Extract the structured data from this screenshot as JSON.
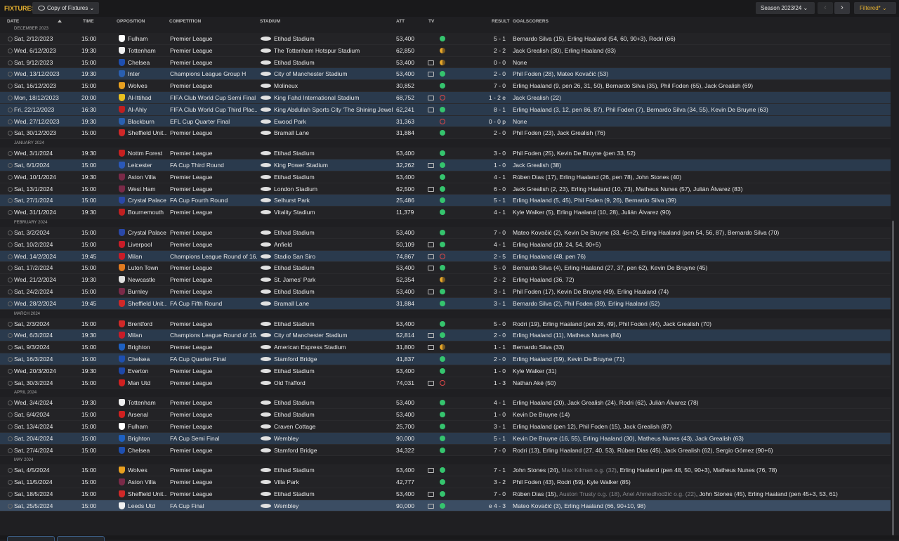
{
  "header": {
    "title": "FIXTURES",
    "view_label": "Copy of Fixtures",
    "season_label": "Season 2023/24",
    "filter_label": "Filtered*"
  },
  "columns": {
    "date": "DATE",
    "time": "TIME",
    "opposition": "OPPOSITION",
    "competition": "COMPETITION",
    "stadium": "STADIUM",
    "att": "ATT",
    "tv": "TV",
    "result": "RESULT",
    "goalscorers": "GOALSCORERS"
  },
  "colors": {
    "accent": "#e7b230",
    "win": "#35c46e",
    "draw": "#e3a52a",
    "loss": "#e04848",
    "highlight": "#2a3a4d",
    "selected": "#3b4d63"
  },
  "months": [
    {
      "label": "DECEMBER 2023",
      "rows": [
        {
          "date": "Sat, 2/12/2023",
          "time": "15:00",
          "opp": "Fulham",
          "crest": "#ffffff",
          "comp": "Premier League",
          "stadium": "Etihad Stadium",
          "att": "53,400",
          "tv": false,
          "status": "win",
          "result": "5 - 1",
          "scorers": "Bernardo Silva (15), Erling Haaland (54, 60, 90+3), Rodri (66)",
          "hl": false
        },
        {
          "date": "Wed, 6/12/2023",
          "time": "19:30",
          "opp": "Tottenham",
          "crest": "#f0f0f0",
          "comp": "Premier League",
          "stadium": "The Tottenham Hotspur Stadium",
          "att": "62,850",
          "tv": false,
          "status": "draw",
          "result": "2 - 2",
          "scorers": "Jack Grealish (30), Erling Haaland (83)",
          "hl": false
        },
        {
          "date": "Sat, 9/12/2023",
          "time": "15:00",
          "opp": "Chelsea",
          "crest": "#1e4fb0",
          "comp": "Premier League",
          "stadium": "Etihad Stadium",
          "att": "53,400",
          "tv": true,
          "status": "draw",
          "result": "0 - 0",
          "scorers": "None",
          "hl": false
        },
        {
          "date": "Wed, 13/12/2023",
          "time": "19:30",
          "opp": "Inter",
          "crest": "#2a5fb0",
          "comp": "Champions League Group H",
          "stadium": "City of Manchester Stadium",
          "att": "53,400",
          "tv": true,
          "status": "win",
          "result": "2 - 0",
          "scorers": "Phil Foden (28), Mateo Kovačić (53)",
          "hl": true
        },
        {
          "date": "Sat, 16/12/2023",
          "time": "15:00",
          "opp": "Wolves",
          "crest": "#e8a020",
          "comp": "Premier League",
          "stadium": "Molineux",
          "att": "30,852",
          "tv": false,
          "status": "win",
          "result": "7 - 0",
          "scorers": "Erling Haaland (9, pen 26, 31, 50), Bernardo Silva (35), Phil Foden (65), Jack Grealish (69)",
          "hl": false
        },
        {
          "date": "Mon, 18/12/2023",
          "time": "20:00",
          "opp": "Al-Ittihad",
          "crest": "#e8c020",
          "comp": "FIFA Club World Cup Semi Final",
          "stadium": "King Fahd International Stadium",
          "att": "68,752",
          "tv": true,
          "status": "loss",
          "result": "1 - 2 e",
          "scorers": "Jack Grealish (22)",
          "hl": true
        },
        {
          "date": "Fri, 22/12/2023",
          "time": "16:30",
          "opp": "Al-Ahly",
          "crest": "#c02020",
          "comp": "FIFA Club World Cup Third Plac...",
          "stadium": "King Abdullah Sports City 'The Shining Jewel'",
          "att": "62,241",
          "tv": true,
          "status": "win",
          "result": "8 - 1",
          "scorers": "Erling Haaland (3, 12, pen 86, 87), Phil Foden (7), Bernardo Silva (34, 55), Kevin De Bruyne (63)",
          "hl": true
        },
        {
          "date": "Wed, 27/12/2023",
          "time": "19:30",
          "opp": "Blackburn",
          "crest": "#2a60b0",
          "comp": "EFL Cup Quarter Final",
          "stadium": "Ewood Park",
          "att": "31,363",
          "tv": false,
          "status": "loss",
          "result": "0 - 0 p",
          "scorers": "None",
          "hl": true
        },
        {
          "date": "Sat, 30/12/2023",
          "time": "15:00",
          "opp": "Sheffield Unit...",
          "crest": "#d02828",
          "comp": "Premier League",
          "stadium": "Bramall Lane",
          "att": "31,884",
          "tv": false,
          "status": "win",
          "result": "2 - 0",
          "scorers": "Phil Foden (23), Jack Grealish (76)",
          "hl": false
        }
      ]
    },
    {
      "label": "JANUARY 2024",
      "rows": [
        {
          "date": "Wed, 3/1/2024",
          "time": "19:30",
          "opp": "Nottm Forest",
          "crest": "#c82020",
          "comp": "Premier League",
          "stadium": "Etihad Stadium",
          "att": "53,400",
          "tv": false,
          "status": "win",
          "result": "3 - 0",
          "scorers": "Phil Foden (25), Kevin De Bruyne (pen 33, 52)",
          "hl": false
        },
        {
          "date": "Sat, 6/1/2024",
          "time": "15:00",
          "opp": "Leicester",
          "crest": "#2a58b8",
          "comp": "FA Cup Third Round",
          "stadium": "King Power Stadium",
          "att": "32,262",
          "tv": true,
          "status": "win",
          "result": "1 - 0",
          "scorers": "Jack Grealish (38)",
          "hl": true
        },
        {
          "date": "Wed, 10/1/2024",
          "time": "19:30",
          "opp": "Aston Villa",
          "crest": "#7a2a48",
          "comp": "Premier League",
          "stadium": "Etihad Stadium",
          "att": "53,400",
          "tv": false,
          "status": "win",
          "result": "4 - 1",
          "scorers": "Rúben Dias (17), Erling Haaland (26, pen 78), John Stones (40)",
          "hl": false
        },
        {
          "date": "Sat, 13/1/2024",
          "time": "15:00",
          "opp": "West Ham",
          "crest": "#7a2a48",
          "comp": "Premier League",
          "stadium": "London Stadium",
          "att": "62,500",
          "tv": true,
          "status": "win",
          "result": "6 - 0",
          "scorers": "Jack Grealish (2, 23), Erling Haaland (10, 73), Matheus Nunes (57), Julián Álvarez (83)",
          "hl": false
        },
        {
          "date": "Sat, 27/1/2024",
          "time": "15:00",
          "opp": "Crystal Palace",
          "crest": "#2a48a8",
          "comp": "FA Cup Fourth Round",
          "stadium": "Selhurst Park",
          "att": "25,486",
          "tv": false,
          "status": "win",
          "result": "5 - 1",
          "scorers": "Erling Haaland (5, 45), Phil Foden (9, 26), Bernardo Silva (39)",
          "hl": true
        },
        {
          "date": "Wed, 31/1/2024",
          "time": "19:30",
          "opp": "Bournemouth",
          "crest": "#c02020",
          "comp": "Premier League",
          "stadium": "Vitality Stadium",
          "att": "11,379",
          "tv": false,
          "status": "win",
          "result": "4 - 1",
          "scorers": "Kyle Walker (5), Erling Haaland (10, 28), Julián Álvarez (90)",
          "hl": false
        }
      ]
    },
    {
      "label": "FEBRUARY 2024",
      "rows": [
        {
          "date": "Sat, 3/2/2024",
          "time": "15:00",
          "opp": "Crystal Palace",
          "crest": "#2a48a8",
          "comp": "Premier League",
          "stadium": "Etihad Stadium",
          "att": "53,400",
          "tv": false,
          "status": "win",
          "result": "7 - 0",
          "scorers": "Mateo Kovačić (2), Kevin De Bruyne (33, 45+2), Erling Haaland (pen 54, 56, 87), Bernardo Silva (70)",
          "hl": false
        },
        {
          "date": "Sat, 10/2/2024",
          "time": "15:00",
          "opp": "Liverpool",
          "crest": "#c81c28",
          "comp": "Premier League",
          "stadium": "Anfield",
          "att": "50,109",
          "tv": true,
          "status": "win",
          "result": "4 - 1",
          "scorers": "Erling Haaland (19, 24, 54, 90+5)",
          "hl": false
        },
        {
          "date": "Wed, 14/2/2024",
          "time": "19:45",
          "opp": "Milan",
          "crest": "#c81c28",
          "comp": "Champions League Round of 16...",
          "stadium": "Stadio San Siro",
          "att": "74,867",
          "tv": true,
          "status": "loss",
          "result": "2 - 5",
          "scorers": "Erling Haaland (48, pen 76)",
          "hl": true
        },
        {
          "date": "Sat, 17/2/2024",
          "time": "15:00",
          "opp": "Luton Town",
          "crest": "#e07a20",
          "comp": "Premier League",
          "stadium": "Etihad Stadium",
          "att": "53,400",
          "tv": true,
          "status": "win",
          "result": "5 - 0",
          "scorers": "Bernardo Silva (4), Erling Haaland (27, 37, pen 62), Kevin De Bruyne (45)",
          "hl": false
        },
        {
          "date": "Wed, 21/2/2024",
          "time": "19:30",
          "opp": "Newcastle",
          "crest": "#e0e0e0",
          "comp": "Premier League",
          "stadium": "St. James' Park",
          "att": "52,354",
          "tv": false,
          "status": "draw",
          "result": "2 - 2",
          "scorers": "Erling Haaland (36, 72)",
          "hl": false
        },
        {
          "date": "Sat, 24/2/2024",
          "time": "15:00",
          "opp": "Burnley",
          "crest": "#7a2a48",
          "comp": "Premier League",
          "stadium": "Etihad Stadium",
          "att": "53,400",
          "tv": true,
          "status": "win",
          "result": "3 - 1",
          "scorers": "Phil Foden (17), Kevin De Bruyne (49), Erling Haaland (74)",
          "hl": false
        },
        {
          "date": "Wed, 28/2/2024",
          "time": "19:45",
          "opp": "Sheffield Unit...",
          "crest": "#d02828",
          "comp": "FA Cup Fifth Round",
          "stadium": "Bramall Lane",
          "att": "31,884",
          "tv": false,
          "status": "win",
          "result": "3 - 1",
          "scorers": "Bernardo Silva (2), Phil Foden (39), Erling Haaland (52)",
          "hl": true
        }
      ]
    },
    {
      "label": "MARCH 2024",
      "rows": [
        {
          "date": "Sat, 2/3/2024",
          "time": "15:00",
          "opp": "Brentford",
          "crest": "#d02828",
          "comp": "Premier League",
          "stadium": "Etihad Stadium",
          "att": "53,400",
          "tv": false,
          "status": "win",
          "result": "5 - 0",
          "scorers": "Rodri (19), Erling Haaland (pen 28, 49), Phil Foden (44), Jack Grealish (70)",
          "hl": false
        },
        {
          "date": "Wed, 6/3/2024",
          "time": "19:30",
          "opp": "Milan",
          "crest": "#c81c28",
          "comp": "Champions League Round of 16...",
          "stadium": "City of Manchester Stadium",
          "att": "52,814",
          "tv": true,
          "status": "win",
          "result": "2 - 0",
          "scorers": "Erling Haaland (11), Matheus Nunes (84)",
          "hl": true
        },
        {
          "date": "Sat, 9/3/2024",
          "time": "15:00",
          "opp": "Brighton",
          "crest": "#1e60c0",
          "comp": "Premier League",
          "stadium": "American Express Stadium",
          "att": "31,800",
          "tv": true,
          "status": "draw",
          "result": "1 - 1",
          "scorers": "Bernardo Silva (33)",
          "hl": false
        },
        {
          "date": "Sat, 16/3/2024",
          "time": "15:00",
          "opp": "Chelsea",
          "crest": "#1e4fb0",
          "comp": "FA Cup Quarter Final",
          "stadium": "Stamford Bridge",
          "att": "41,837",
          "tv": false,
          "status": "win",
          "result": "2 - 0",
          "scorers": "Erling Haaland (59), Kevin De Bruyne (71)",
          "hl": true
        },
        {
          "date": "Wed, 20/3/2024",
          "time": "19:30",
          "opp": "Everton",
          "crest": "#1e48a8",
          "comp": "Premier League",
          "stadium": "Etihad Stadium",
          "att": "53,400",
          "tv": false,
          "status": "win",
          "result": "1 - 0",
          "scorers": "Kyle Walker (31)",
          "hl": false
        },
        {
          "date": "Sat, 30/3/2024",
          "time": "15:00",
          "opp": "Man Utd",
          "crest": "#d02020",
          "comp": "Premier League",
          "stadium": "Old Trafford",
          "att": "74,031",
          "tv": true,
          "status": "loss",
          "result": "1 - 3",
          "scorers": "Nathan Aké (50)",
          "hl": false
        }
      ]
    },
    {
      "label": "APRIL 2024",
      "rows": [
        {
          "date": "Wed, 3/4/2024",
          "time": "19:30",
          "opp": "Tottenham",
          "crest": "#f0f0f0",
          "comp": "Premier League",
          "stadium": "Etihad Stadium",
          "att": "53,400",
          "tv": false,
          "status": "win",
          "result": "4 - 1",
          "scorers": "Erling Haaland (20), Jack Grealish (24), Rodri (62), Julián Álvarez (78)",
          "hl": false
        },
        {
          "date": "Sat, 6/4/2024",
          "time": "15:00",
          "opp": "Arsenal",
          "crest": "#d02020",
          "comp": "Premier League",
          "stadium": "Etihad Stadium",
          "att": "53,400",
          "tv": false,
          "status": "win",
          "result": "1 - 0",
          "scorers": "Kevin De Bruyne (14)",
          "hl": false
        },
        {
          "date": "Sat, 13/4/2024",
          "time": "15:00",
          "opp": "Fulham",
          "crest": "#ffffff",
          "comp": "Premier League",
          "stadium": "Craven Cottage",
          "att": "25,700",
          "tv": false,
          "status": "win",
          "result": "3 - 1",
          "scorers": "Erling Haaland (pen 12), Phil Foden (15), Jack Grealish (87)",
          "hl": false
        },
        {
          "date": "Sat, 20/4/2024",
          "time": "15:00",
          "opp": "Brighton",
          "crest": "#1e60c0",
          "comp": "FA Cup Semi Final",
          "stadium": "Wembley",
          "att": "90,000",
          "tv": false,
          "status": "win",
          "result": "5 - 1",
          "scorers": "Kevin De Bruyne (16, 55), Erling Haaland (30), Matheus Nunes (43), Jack Grealish (63)",
          "hl": true
        },
        {
          "date": "Sat, 27/4/2024",
          "time": "15:00",
          "opp": "Chelsea",
          "crest": "#1e4fb0",
          "comp": "Premier League",
          "stadium": "Stamford Bridge",
          "att": "34,322",
          "tv": false,
          "status": "win",
          "result": "7 - 0",
          "scorers": "Rodri (13), Erling Haaland (27, 40, 53), Rúben Dias (45), Jack Grealish (62), Sergio Gómez (90+6)",
          "hl": false
        }
      ]
    },
    {
      "label": "MAY 2024",
      "rows": [
        {
          "date": "Sat, 4/5/2024",
          "time": "15:00",
          "opp": "Wolves",
          "crest": "#e8a020",
          "comp": "Premier League",
          "stadium": "Etihad Stadium",
          "att": "53,400",
          "tv": true,
          "status": "win",
          "result": "7 - 1",
          "scorers": "John Stones (24), ",
          "scorers_dim": "Max Kilman o.g. (32)",
          "scorers_rest": ", Erling Haaland (pen 48, 50, 90+3), Matheus Nunes (76, 78)",
          "hl": false
        },
        {
          "date": "Sat, 11/5/2024",
          "time": "15:00",
          "opp": "Aston Villa",
          "crest": "#7a2a48",
          "comp": "Premier League",
          "stadium": "Villa Park",
          "att": "42,777",
          "tv": false,
          "status": "win",
          "result": "3 - 2",
          "scorers": "Phil Foden (43), Rodri (59), Kyle Walker (85)",
          "hl": false
        },
        {
          "date": "Sat, 18/5/2024",
          "time": "15:00",
          "opp": "Sheffield Unit...",
          "crest": "#d02828",
          "comp": "Premier League",
          "stadium": "Etihad Stadium",
          "att": "53,400",
          "tv": true,
          "status": "win",
          "result": "7 - 0",
          "scorers": "Rúben Dias (15), ",
          "scorers_dim": "Auston Trusty o.g. (18), Anel Ahmedhodžić o.g. (22)",
          "scorers_rest": ", John Stones (45), Erling Haaland (pen 45+3, 53, 61)",
          "hl": false
        },
        {
          "date": "Sat, 25/5/2024",
          "time": "15:00",
          "opp": "Leeds Utd",
          "crest": "#f0f0f0",
          "comp": "FA Cup Final",
          "stadium": "Wembley",
          "att": "90,000",
          "tv": true,
          "status": "win",
          "result": "e 4 - 3",
          "scorers": "Mateo Kovačić (3), Erling Haaland (66, 90+10, 98)",
          "hl": true,
          "selected": true
        }
      ]
    }
  ]
}
